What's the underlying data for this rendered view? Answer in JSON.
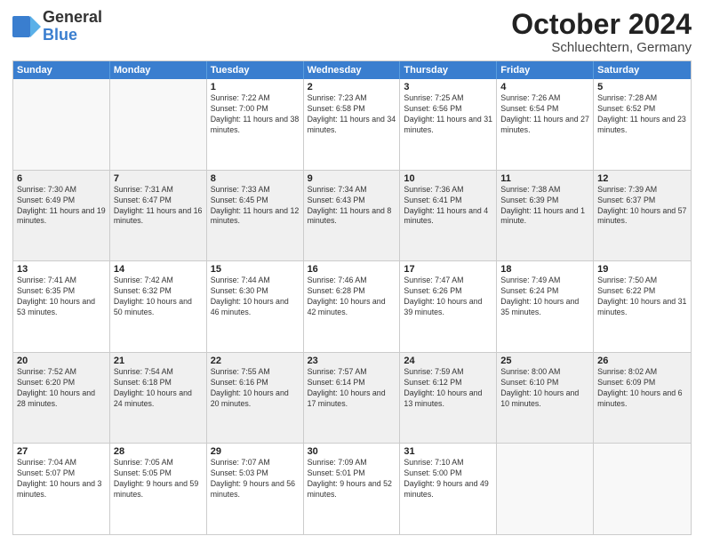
{
  "header": {
    "logo_line1": "General",
    "logo_line2": "Blue",
    "month_title": "October 2024",
    "subtitle": "Schluechtern, Germany"
  },
  "days_of_week": [
    "Sunday",
    "Monday",
    "Tuesday",
    "Wednesday",
    "Thursday",
    "Friday",
    "Saturday"
  ],
  "weeks": [
    [
      {
        "day": "",
        "sunrise": "",
        "sunset": "",
        "daylight": "",
        "empty": true
      },
      {
        "day": "",
        "sunrise": "",
        "sunset": "",
        "daylight": "",
        "empty": true
      },
      {
        "day": "1",
        "sunrise": "Sunrise: 7:22 AM",
        "sunset": "Sunset: 7:00 PM",
        "daylight": "Daylight: 11 hours and 38 minutes."
      },
      {
        "day": "2",
        "sunrise": "Sunrise: 7:23 AM",
        "sunset": "Sunset: 6:58 PM",
        "daylight": "Daylight: 11 hours and 34 minutes."
      },
      {
        "day": "3",
        "sunrise": "Sunrise: 7:25 AM",
        "sunset": "Sunset: 6:56 PM",
        "daylight": "Daylight: 11 hours and 31 minutes."
      },
      {
        "day": "4",
        "sunrise": "Sunrise: 7:26 AM",
        "sunset": "Sunset: 6:54 PM",
        "daylight": "Daylight: 11 hours and 27 minutes."
      },
      {
        "day": "5",
        "sunrise": "Sunrise: 7:28 AM",
        "sunset": "Sunset: 6:52 PM",
        "daylight": "Daylight: 11 hours and 23 minutes."
      }
    ],
    [
      {
        "day": "6",
        "sunrise": "Sunrise: 7:30 AM",
        "sunset": "Sunset: 6:49 PM",
        "daylight": "Daylight: 11 hours and 19 minutes."
      },
      {
        "day": "7",
        "sunrise": "Sunrise: 7:31 AM",
        "sunset": "Sunset: 6:47 PM",
        "daylight": "Daylight: 11 hours and 16 minutes."
      },
      {
        "day": "8",
        "sunrise": "Sunrise: 7:33 AM",
        "sunset": "Sunset: 6:45 PM",
        "daylight": "Daylight: 11 hours and 12 minutes."
      },
      {
        "day": "9",
        "sunrise": "Sunrise: 7:34 AM",
        "sunset": "Sunset: 6:43 PM",
        "daylight": "Daylight: 11 hours and 8 minutes."
      },
      {
        "day": "10",
        "sunrise": "Sunrise: 7:36 AM",
        "sunset": "Sunset: 6:41 PM",
        "daylight": "Daylight: 11 hours and 4 minutes."
      },
      {
        "day": "11",
        "sunrise": "Sunrise: 7:38 AM",
        "sunset": "Sunset: 6:39 PM",
        "daylight": "Daylight: 11 hours and 1 minute."
      },
      {
        "day": "12",
        "sunrise": "Sunrise: 7:39 AM",
        "sunset": "Sunset: 6:37 PM",
        "daylight": "Daylight: 10 hours and 57 minutes."
      }
    ],
    [
      {
        "day": "13",
        "sunrise": "Sunrise: 7:41 AM",
        "sunset": "Sunset: 6:35 PM",
        "daylight": "Daylight: 10 hours and 53 minutes."
      },
      {
        "day": "14",
        "sunrise": "Sunrise: 7:42 AM",
        "sunset": "Sunset: 6:32 PM",
        "daylight": "Daylight: 10 hours and 50 minutes."
      },
      {
        "day": "15",
        "sunrise": "Sunrise: 7:44 AM",
        "sunset": "Sunset: 6:30 PM",
        "daylight": "Daylight: 10 hours and 46 minutes."
      },
      {
        "day": "16",
        "sunrise": "Sunrise: 7:46 AM",
        "sunset": "Sunset: 6:28 PM",
        "daylight": "Daylight: 10 hours and 42 minutes."
      },
      {
        "day": "17",
        "sunrise": "Sunrise: 7:47 AM",
        "sunset": "Sunset: 6:26 PM",
        "daylight": "Daylight: 10 hours and 39 minutes."
      },
      {
        "day": "18",
        "sunrise": "Sunrise: 7:49 AM",
        "sunset": "Sunset: 6:24 PM",
        "daylight": "Daylight: 10 hours and 35 minutes."
      },
      {
        "day": "19",
        "sunrise": "Sunrise: 7:50 AM",
        "sunset": "Sunset: 6:22 PM",
        "daylight": "Daylight: 10 hours and 31 minutes."
      }
    ],
    [
      {
        "day": "20",
        "sunrise": "Sunrise: 7:52 AM",
        "sunset": "Sunset: 6:20 PM",
        "daylight": "Daylight: 10 hours and 28 minutes."
      },
      {
        "day": "21",
        "sunrise": "Sunrise: 7:54 AM",
        "sunset": "Sunset: 6:18 PM",
        "daylight": "Daylight: 10 hours and 24 minutes."
      },
      {
        "day": "22",
        "sunrise": "Sunrise: 7:55 AM",
        "sunset": "Sunset: 6:16 PM",
        "daylight": "Daylight: 10 hours and 20 minutes."
      },
      {
        "day": "23",
        "sunrise": "Sunrise: 7:57 AM",
        "sunset": "Sunset: 6:14 PM",
        "daylight": "Daylight: 10 hours and 17 minutes."
      },
      {
        "day": "24",
        "sunrise": "Sunrise: 7:59 AM",
        "sunset": "Sunset: 6:12 PM",
        "daylight": "Daylight: 10 hours and 13 minutes."
      },
      {
        "day": "25",
        "sunrise": "Sunrise: 8:00 AM",
        "sunset": "Sunset: 6:10 PM",
        "daylight": "Daylight: 10 hours and 10 minutes."
      },
      {
        "day": "26",
        "sunrise": "Sunrise: 8:02 AM",
        "sunset": "Sunset: 6:09 PM",
        "daylight": "Daylight: 10 hours and 6 minutes."
      }
    ],
    [
      {
        "day": "27",
        "sunrise": "Sunrise: 7:04 AM",
        "sunset": "Sunset: 5:07 PM",
        "daylight": "Daylight: 10 hours and 3 minutes."
      },
      {
        "day": "28",
        "sunrise": "Sunrise: 7:05 AM",
        "sunset": "Sunset: 5:05 PM",
        "daylight": "Daylight: 9 hours and 59 minutes."
      },
      {
        "day": "29",
        "sunrise": "Sunrise: 7:07 AM",
        "sunset": "Sunset: 5:03 PM",
        "daylight": "Daylight: 9 hours and 56 minutes."
      },
      {
        "day": "30",
        "sunrise": "Sunrise: 7:09 AM",
        "sunset": "Sunset: 5:01 PM",
        "daylight": "Daylight: 9 hours and 52 minutes."
      },
      {
        "day": "31",
        "sunrise": "Sunrise: 7:10 AM",
        "sunset": "Sunset: 5:00 PM",
        "daylight": "Daylight: 9 hours and 49 minutes."
      },
      {
        "day": "",
        "sunrise": "",
        "sunset": "",
        "daylight": "",
        "empty": true
      },
      {
        "day": "",
        "sunrise": "",
        "sunset": "",
        "daylight": "",
        "empty": true
      }
    ]
  ]
}
